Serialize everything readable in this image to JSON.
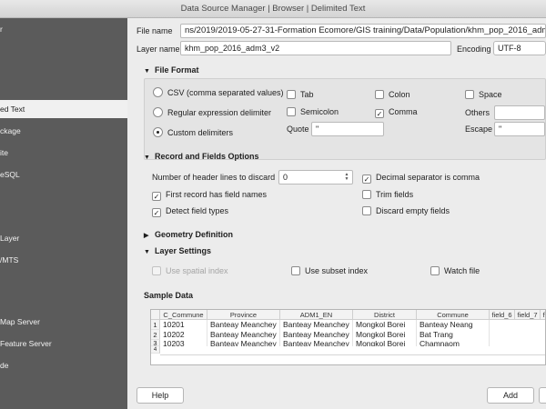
{
  "window": {
    "title": "Data Source Manager | Browser | Delimited Text"
  },
  "sidebar": {
    "items": [
      {
        "label": "r"
      },
      {
        "label": "ed Text"
      },
      {
        "label": "ckage"
      },
      {
        "label": "ite"
      },
      {
        "label": "eSQL"
      },
      {
        "label": "Layer"
      },
      {
        "label": "/MTS"
      },
      {
        "label": "Map Server"
      },
      {
        "label": "Feature Server"
      },
      {
        "label": "de"
      }
    ]
  },
  "form": {
    "file_name_label": "File name",
    "file_name_value": "ns/2019/2019-05-27-31-Formation Ecomore/GIS training/Data/Population/khm_pop_2016_adm3_v2.csv",
    "layer_name_label": "Layer name",
    "layer_name_value": "khm_pop_2016_adm3_v2",
    "encoding_label": "Encoding",
    "encoding_value": "UTF-8"
  },
  "file_format": {
    "title": "File Format",
    "radio_csv": "CSV (comma separated values)",
    "radio_regex": "Regular expression delimiter",
    "radio_custom": "Custom delimiters",
    "tab": "Tab",
    "colon": "Colon",
    "space": "Space",
    "semicolon": "Semicolon",
    "comma": "Comma",
    "others_label": "Others",
    "quote_label": "Quote",
    "quote_value": "\"",
    "escape_label": "Escape",
    "escape_value": "\""
  },
  "record_options": {
    "title": "Record and Fields Options",
    "header_lines_label": "Number of header lines to discard",
    "header_lines_value": "0",
    "decimal_comma": "Decimal separator is comma",
    "first_record_names": "First record has field names",
    "trim_fields": "Trim fields",
    "detect_types": "Detect field types",
    "discard_empty": "Discard empty fields"
  },
  "geometry": {
    "title": "Geometry Definition"
  },
  "layer_settings": {
    "title": "Layer Settings",
    "spatial_index": "Use spatial index",
    "subset_index": "Use subset index",
    "watch_file": "Watch file"
  },
  "sample": {
    "title": "Sample Data",
    "columns": [
      "C_Commune",
      "Province",
      "ADM1_EN",
      "District",
      "Commune",
      "field_6",
      "field_7",
      "fi"
    ],
    "rows": [
      [
        "1",
        "10201",
        "Banteay Meanchey",
        "Banteay Meanchey",
        "Mongkol Borei",
        "Banteay Neang"
      ],
      [
        "2",
        "10202",
        "Banteay Meanchey",
        "Banteay Meanchey",
        "Mongkol Borei",
        "Bat Trang"
      ],
      [
        "3",
        "10203",
        "Banteay Meanchey",
        "Banteay Meanchey",
        "Mongkol Borei",
        "Chamnaom"
      ],
      [
        "4",
        "",
        "",
        "",
        "",
        ""
      ]
    ]
  },
  "buttons": {
    "help": "Help",
    "add": "Add"
  }
}
